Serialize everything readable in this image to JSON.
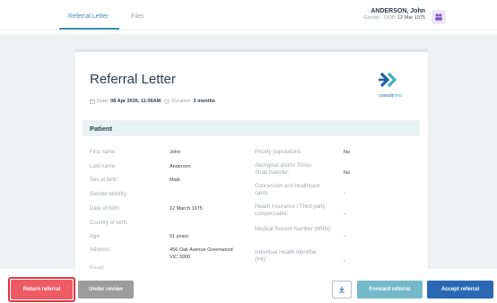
{
  "tabs": [
    {
      "label": "Referral Letter",
      "active": true
    },
    {
      "label": "Files",
      "active": false
    }
  ],
  "patient": {
    "name": "ANDERSON, John",
    "gender_label": "Gender",
    "dob_label": "DOB:",
    "dob": "12 Mar 1975"
  },
  "document": {
    "title": "Referral Letter",
    "date_label": "Date:",
    "date_value": "08 Apr 2026, 11:06AM",
    "duration_label": "Duration:",
    "duration_value": "3 months",
    "logo_brand_part1": "consult",
    "logo_brand_part2": "med"
  },
  "section": {
    "title": "Patient"
  },
  "left_fields": [
    {
      "label": "First name:",
      "value": "John"
    },
    {
      "label": "Last name:",
      "value": "Anderson"
    },
    {
      "label": "Sex at birth:",
      "value": "Male"
    },
    {
      "label": "Gender identity:",
      "value": ""
    },
    {
      "label": "Date of birth:",
      "value": "12 March 1975"
    },
    {
      "label": "Country of birth:",
      "value": ""
    },
    {
      "label": "Age:",
      "value": "51 years"
    },
    {
      "label": "Address:",
      "value": "456 Oak Avenue Greenwood VIC 3000"
    },
    {
      "label": "Email:",
      "value": ""
    }
  ],
  "right_fields": [
    {
      "label": "Priority populations:",
      "value": "No"
    },
    {
      "label": "Aboriginal and/or Torres Strait Islander:",
      "value": "No"
    },
    {
      "label": "Concession and healthcare cards:",
      "value": "-"
    },
    {
      "label": "Health insurance / Third party compensable:",
      "value": "-"
    },
    {
      "label": "Medical Record Number (MRN):",
      "value": "-"
    },
    {
      "label": "Individual Health Identifier (IHI):",
      "value": "-"
    }
  ],
  "actions": {
    "return": "Return referral",
    "review": "Under review",
    "forward": "Forward referral",
    "accept": "Accept referral"
  },
  "colors": {
    "accent": "#3f8fb3",
    "return": "#ef5b65",
    "return_outline": "#e23440",
    "review": "#9c9c9c",
    "forward": "#74b9c9",
    "accept": "#2b68b4",
    "section_bg": "#e6f3f2"
  },
  "icons": [
    "calendar-icon",
    "clock-icon",
    "users-icon",
    "download-icon",
    "consultmed-logo-icon"
  ]
}
